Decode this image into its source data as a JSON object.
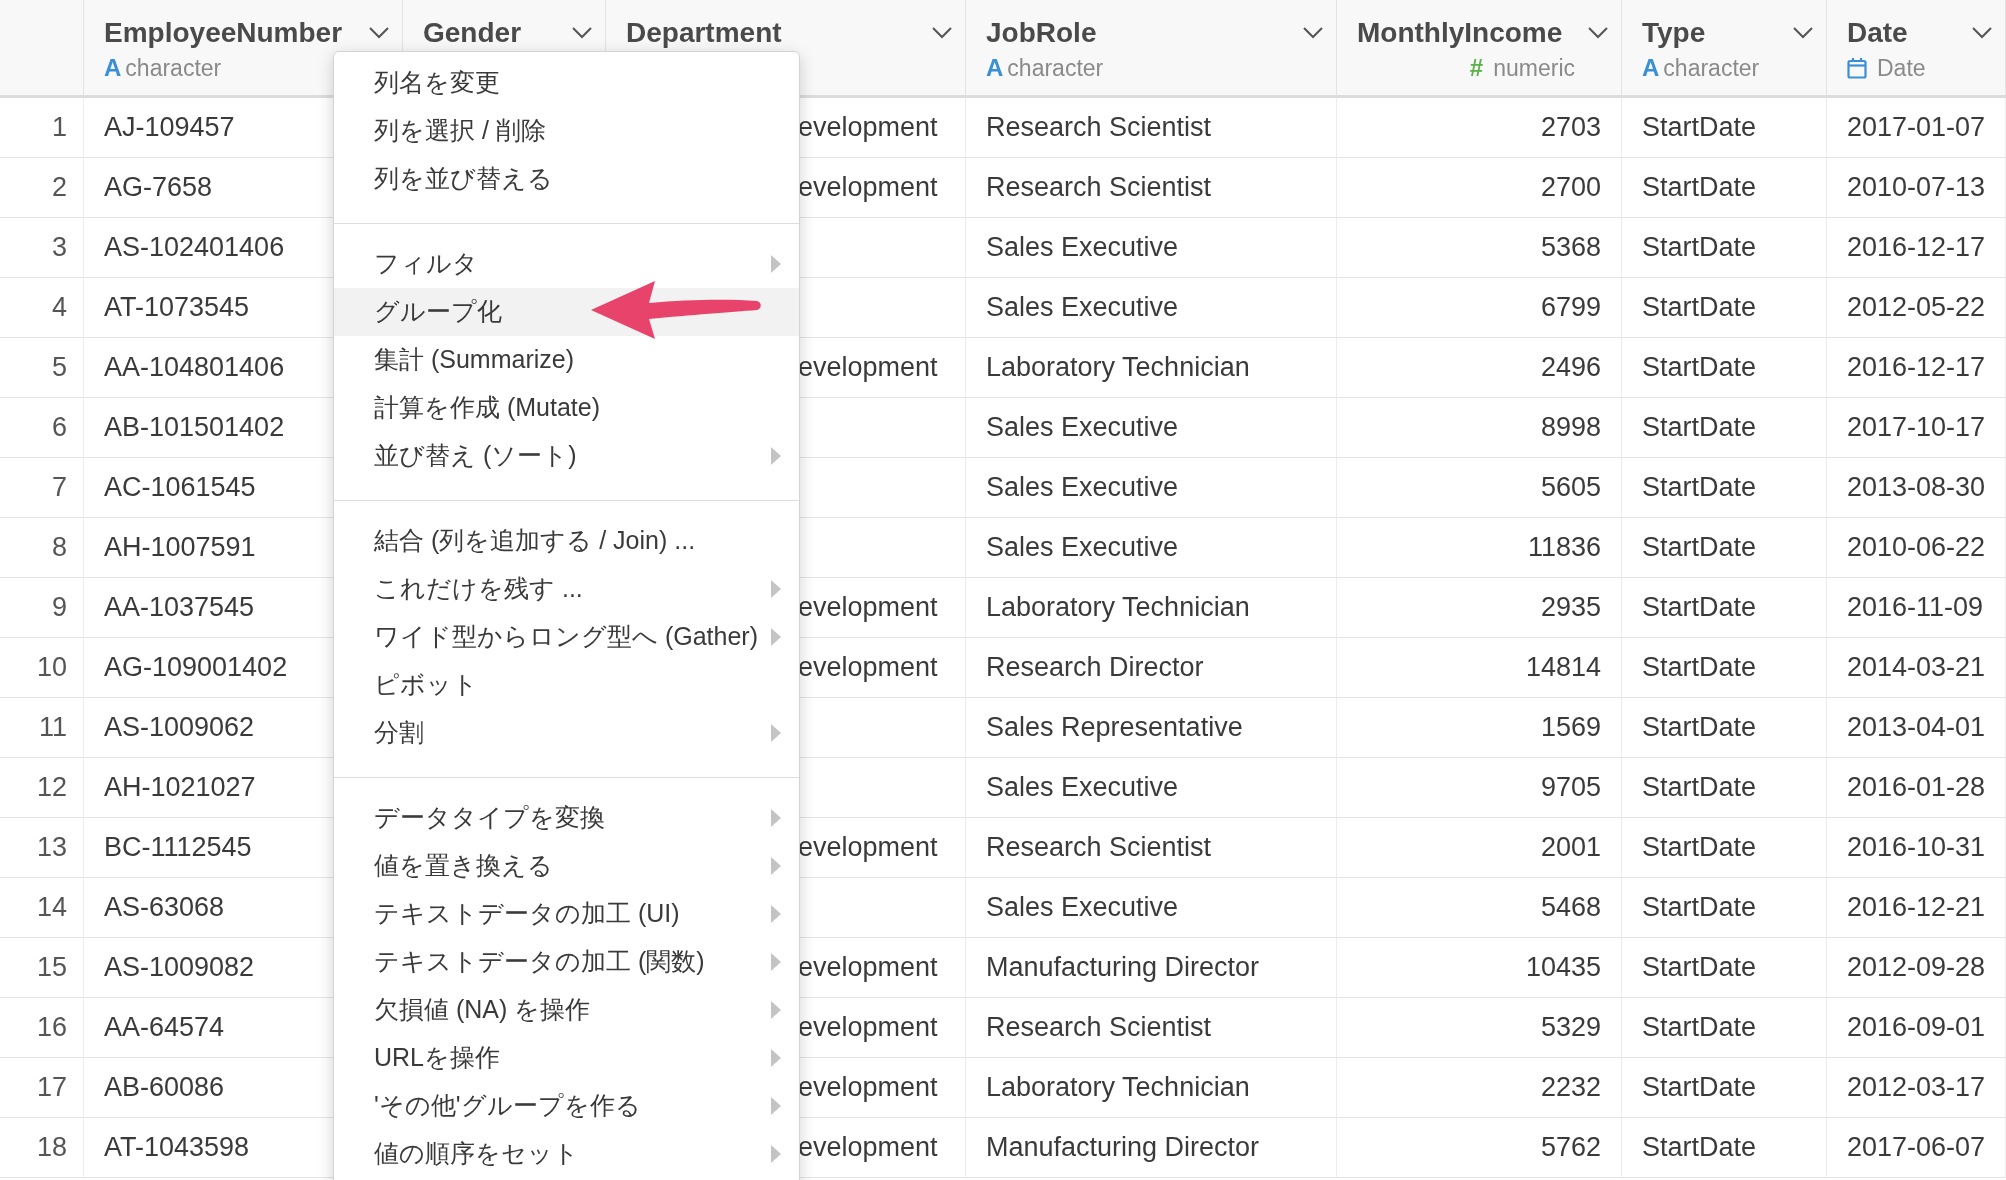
{
  "columns": [
    {
      "name": "EmployeeNumber",
      "type": {
        "kind": "character",
        "icon": "A",
        "label": "character"
      }
    },
    {
      "name": "Gender"
    },
    {
      "name": "Department"
    },
    {
      "name": "JobRole",
      "type": {
        "kind": "character",
        "icon": "A",
        "label": "character"
      }
    },
    {
      "name": "MonthlyIncome",
      "type": {
        "kind": "numeric",
        "icon": "#",
        "label": "numeric"
      }
    },
    {
      "name": "Type",
      "type": {
        "kind": "character",
        "icon": "A",
        "label": "character"
      }
    },
    {
      "name": "Date",
      "type": {
        "kind": "date",
        "label": "Date"
      }
    }
  ],
  "rows": [
    {
      "number": "1",
      "employee_number": "AJ-109457",
      "department": "evelopment",
      "job_role": "Research Scientist",
      "monthly_income": "2703",
      "type": "StartDate",
      "date": "2017-01-07"
    },
    {
      "number": "2",
      "employee_number": "AG-7658",
      "department": "evelopment",
      "job_role": "Research Scientist",
      "monthly_income": "2700",
      "type": "StartDate",
      "date": "2010-07-13"
    },
    {
      "number": "3",
      "employee_number": "AS-102401406",
      "job_role": "Sales Executive",
      "monthly_income": "5368",
      "type": "StartDate",
      "date": "2016-12-17"
    },
    {
      "number": "4",
      "employee_number": "AT-1073545",
      "job_role": "Sales Executive",
      "monthly_income": "6799",
      "type": "StartDate",
      "date": "2012-05-22"
    },
    {
      "number": "5",
      "employee_number": "AA-104801406",
      "department": "evelopment",
      "job_role": "Laboratory Technician",
      "monthly_income": "2496",
      "type": "StartDate",
      "date": "2016-12-17"
    },
    {
      "number": "6",
      "employee_number": "AB-101501402",
      "job_role": "Sales Executive",
      "monthly_income": "8998",
      "type": "StartDate",
      "date": "2017-10-17"
    },
    {
      "number": "7",
      "employee_number": "AC-1061545",
      "job_role": "Sales Executive",
      "monthly_income": "5605",
      "type": "StartDate",
      "date": "2013-08-30"
    },
    {
      "number": "8",
      "employee_number": "AH-1007591",
      "job_role": "Sales Executive",
      "monthly_income": "11836",
      "type": "StartDate",
      "date": "2010-06-22"
    },
    {
      "number": "9",
      "employee_number": "AA-1037545",
      "department": "evelopment",
      "job_role": "Laboratory Technician",
      "monthly_income": "2935",
      "type": "StartDate",
      "date": "2016-11-09"
    },
    {
      "number": "10",
      "employee_number": "AG-109001402",
      "department": "evelopment",
      "job_role": "Research Director",
      "monthly_income": "14814",
      "type": "StartDate",
      "date": "2014-03-21"
    },
    {
      "number": "11",
      "employee_number": "AS-1009062",
      "job_role": "Sales Representative",
      "monthly_income": "1569",
      "type": "StartDate",
      "date": "2013-04-01"
    },
    {
      "number": "12",
      "employee_number": "AH-1021027",
      "job_role": "Sales Executive",
      "monthly_income": "9705",
      "type": "StartDate",
      "date": "2016-01-28"
    },
    {
      "number": "13",
      "employee_number": "BC-1112545",
      "department": "evelopment",
      "job_role": "Research Scientist",
      "monthly_income": "2001",
      "type": "StartDate",
      "date": "2016-10-31"
    },
    {
      "number": "14",
      "employee_number": "AS-63068",
      "job_role": "Sales Executive",
      "monthly_income": "5468",
      "type": "StartDate",
      "date": "2016-12-21"
    },
    {
      "number": "15",
      "employee_number": "AS-1009082",
      "department": "evelopment",
      "job_role": "Manufacturing Director",
      "monthly_income": "10435",
      "type": "StartDate",
      "date": "2012-09-28"
    },
    {
      "number": "16",
      "employee_number": "AA-64574",
      "department": "evelopment",
      "job_role": "Research Scientist",
      "monthly_income": "5329",
      "type": "StartDate",
      "date": "2016-09-01"
    },
    {
      "number": "17",
      "employee_number": "AB-60086",
      "department": "evelopment",
      "job_role": "Laboratory Technician",
      "monthly_income": "2232",
      "type": "StartDate",
      "date": "2012-03-17"
    },
    {
      "number": "18",
      "employee_number": "AT-1043598",
      "department": "evelopment",
      "job_role": "Manufacturing Director",
      "monthly_income": "5762",
      "type": "StartDate",
      "date": "2017-06-07"
    }
  ],
  "context_menu": {
    "groups": [
      [
        {
          "label": "列名を変更",
          "submenu": false,
          "selected": false
        },
        {
          "label": "列を選択 / 削除",
          "submenu": false,
          "selected": false
        },
        {
          "label": "列を並び替える",
          "submenu": false,
          "selected": false
        }
      ],
      [
        {
          "label": "フィルタ",
          "submenu": true,
          "selected": false
        },
        {
          "label": "グループ化",
          "submenu": false,
          "selected": true
        },
        {
          "label": "集計 (Summarize)",
          "submenu": false,
          "selected": false
        },
        {
          "label": "計算を作成 (Mutate)",
          "submenu": false,
          "selected": false
        },
        {
          "label": "並び替え (ソート)",
          "submenu": true,
          "selected": false
        }
      ],
      [
        {
          "label": "結合 (列を追加する / Join) ...",
          "submenu": false,
          "selected": false
        },
        {
          "label": "これだけを残す ...",
          "submenu": true,
          "selected": false
        },
        {
          "label": "ワイド型からロング型へ (Gather)",
          "submenu": true,
          "selected": false
        },
        {
          "label": "ピボット",
          "submenu": false,
          "selected": false
        },
        {
          "label": "分割",
          "submenu": true,
          "selected": false
        }
      ],
      [
        {
          "label": "データタイプを変換",
          "submenu": true,
          "selected": false
        },
        {
          "label": "値を置き換える",
          "submenu": true,
          "selected": false
        },
        {
          "label": "テキストデータの加工 (UI)",
          "submenu": true,
          "selected": false
        },
        {
          "label": "テキストデータの加工 (関数)",
          "submenu": true,
          "selected": false
        },
        {
          "label": "欠損値 (NA) を操作",
          "submenu": true,
          "selected": false
        },
        {
          "label": "URLを操作",
          "submenu": true,
          "selected": false
        },
        {
          "label": "'その他'グループを作る",
          "submenu": true,
          "selected": false
        },
        {
          "label": "値の順序をセット",
          "submenu": true,
          "selected": false
        }
      ]
    ]
  }
}
